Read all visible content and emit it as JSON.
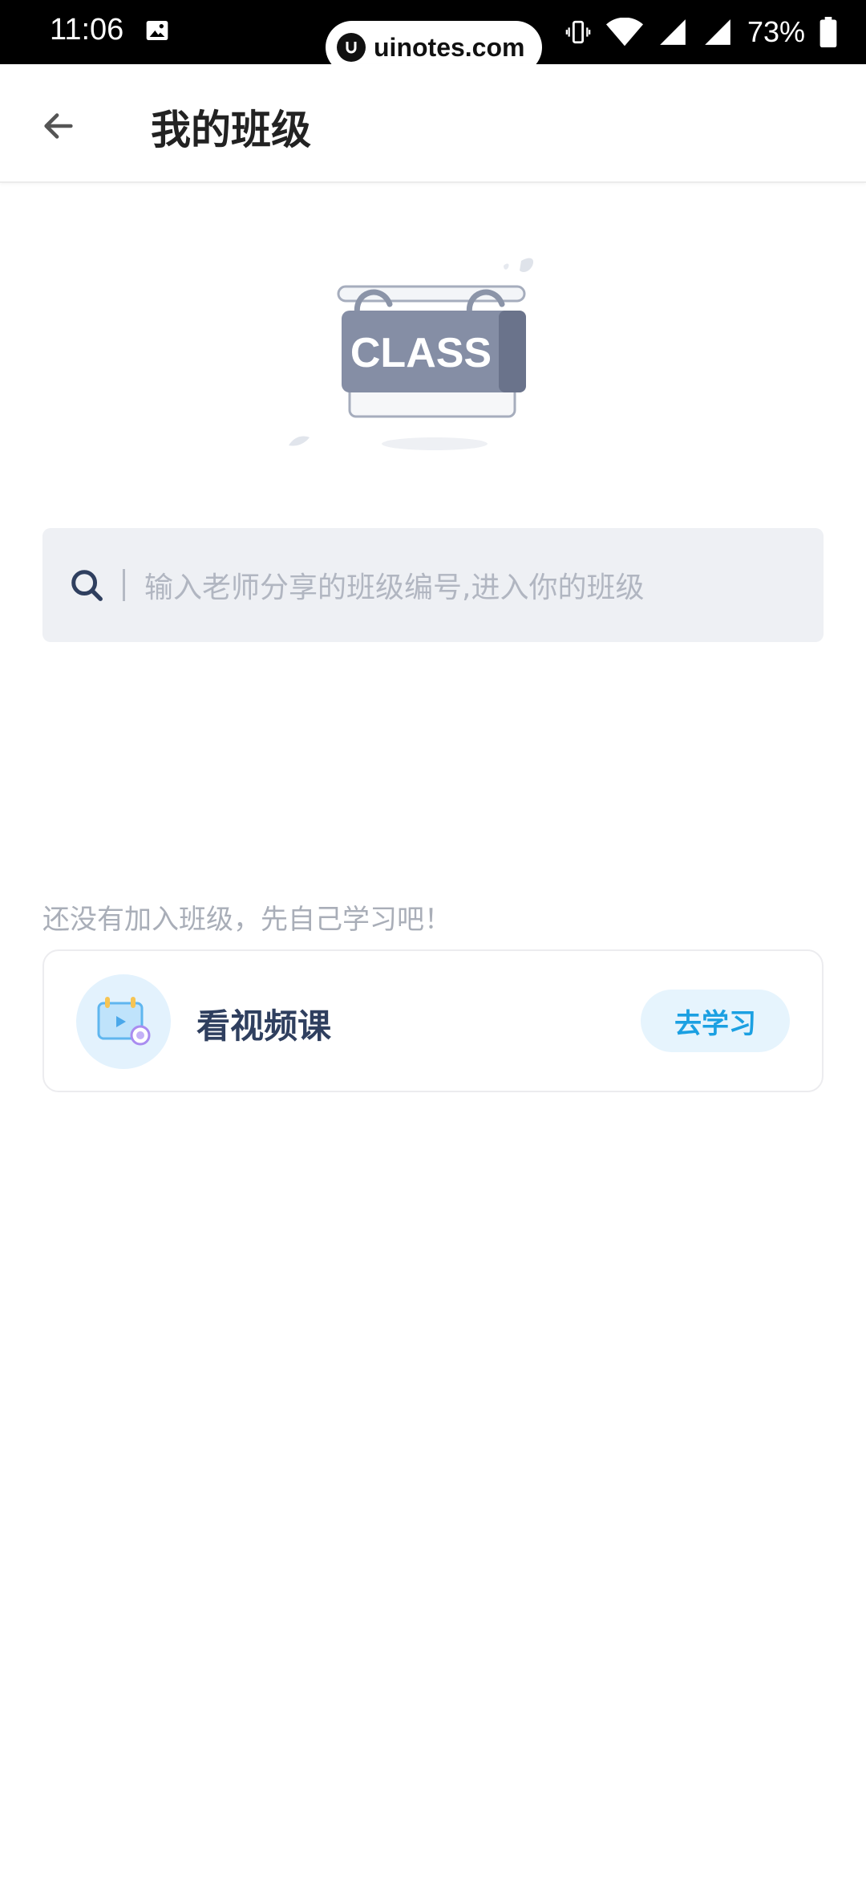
{
  "status_bar": {
    "time": "11:06",
    "battery": "73%",
    "watermark": "uinotes.com"
  },
  "header": {
    "title": "我的班级",
    "back_icon": "arrow-left-icon"
  },
  "illustration": {
    "sign_text": "CLASS"
  },
  "search": {
    "placeholder": "输入老师分享的班级编号,进入你的班级",
    "icon": "search-icon"
  },
  "hint": "还没有加入班级，先自己学习吧！",
  "course_card": {
    "title": "看视频课",
    "button_label": "去学习",
    "icon": "video-course-icon"
  },
  "colors": {
    "accent": "#1ba0e2",
    "accent_bg": "#e6f4fd",
    "search_bg": "#eef0f4",
    "title_text": "#222222",
    "card_title": "#2f3f5f"
  }
}
